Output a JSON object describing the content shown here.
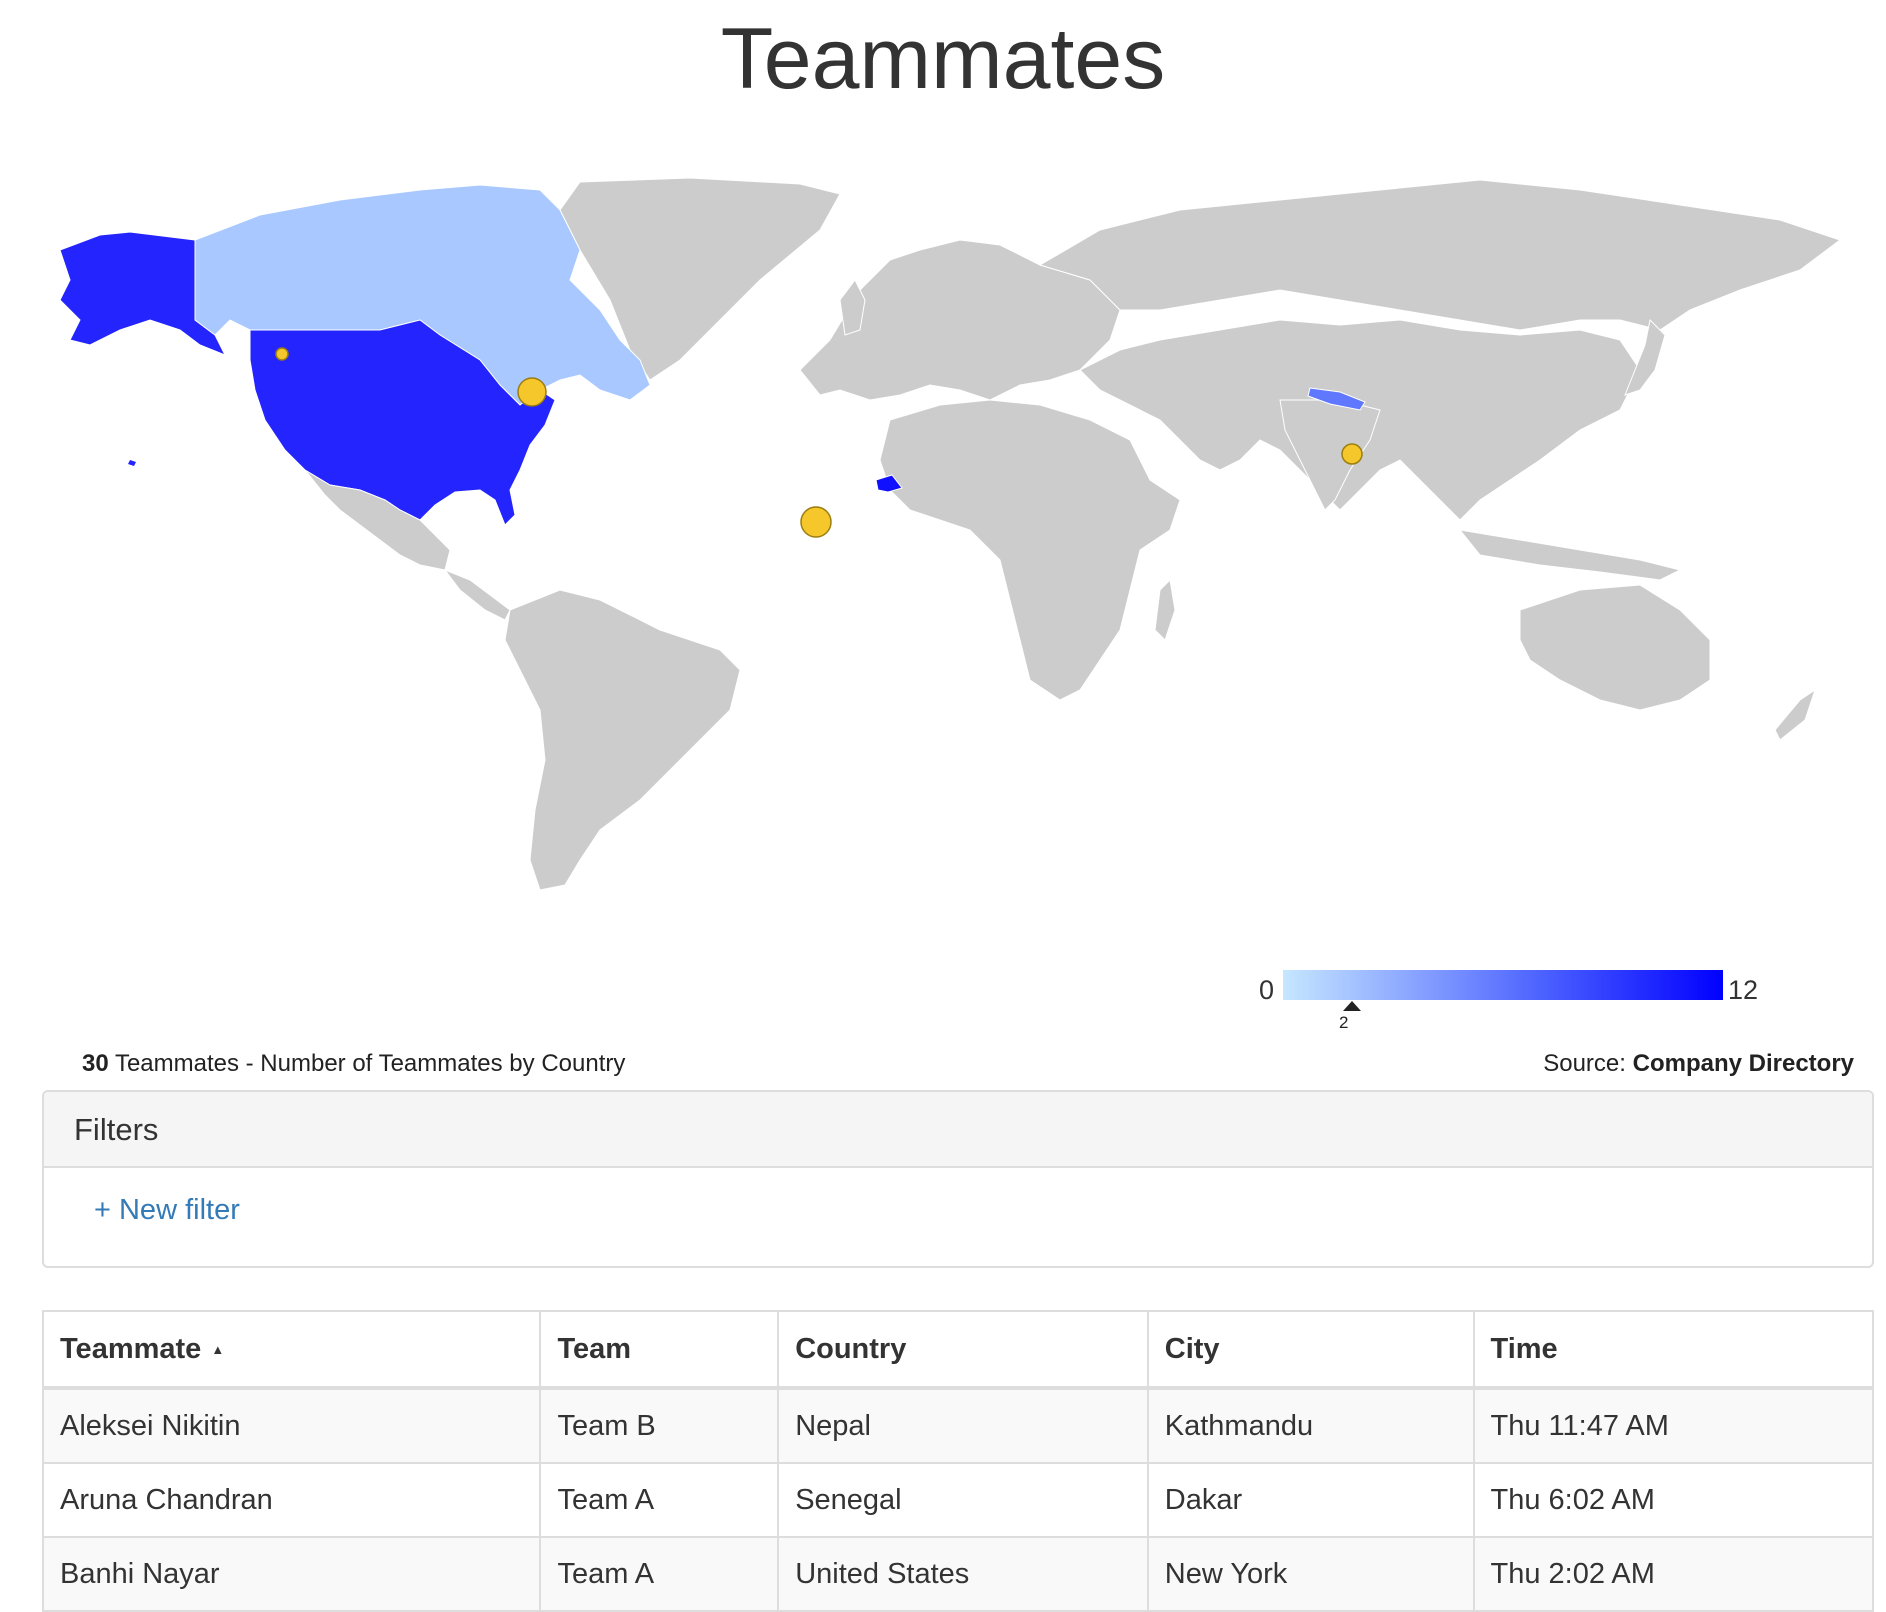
{
  "page": {
    "title": "Teammates"
  },
  "map": {
    "highlight_colors": {
      "United States": "#2424ff",
      "Alaska (US)": "#2424ff",
      "Canada": "#a8c8ff",
      "Nepal": "#5f78ff",
      "Senegal": "#1010ff",
      "other": "#cccccc",
      "bubble": "#f5c72b"
    },
    "legend": {
      "min": "0",
      "max": "12",
      "marker": "2"
    }
  },
  "caption": {
    "count": "30",
    "text": " Teammates - Number of Teammates by Country"
  },
  "source": {
    "label": "Source: ",
    "name": "Company Directory"
  },
  "filters": {
    "title": "Filters",
    "new_filter": "+ New filter"
  },
  "table": {
    "headers": [
      "Teammate",
      "Team",
      "Country",
      "City",
      "Time"
    ],
    "sort_indicator": "▲",
    "rows": [
      [
        "Aleksei Nikitin",
        "Team B",
        "Nepal",
        "Kathmandu",
        "Thu 11:47 AM"
      ],
      [
        "Aruna Chandran",
        "Team A",
        "Senegal",
        "Dakar",
        "Thu 6:02 AM"
      ],
      [
        "Banhi Nayar",
        "Team A",
        "United States",
        "New York",
        "Thu 2:02 AM"
      ]
    ]
  }
}
